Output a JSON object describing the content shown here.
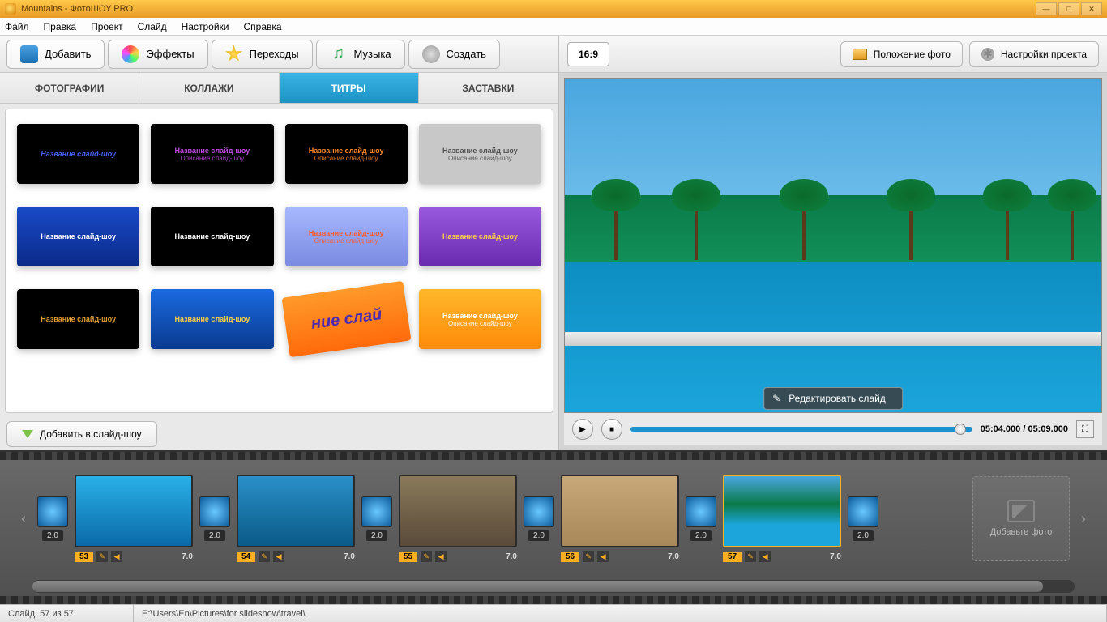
{
  "window": {
    "title": "Mountains - ФотоШОУ PRO"
  },
  "menu": [
    "Файл",
    "Правка",
    "Проект",
    "Слайд",
    "Настройки",
    "Справка"
  ],
  "toolbar": {
    "add": "Добавить",
    "effects": "Эффекты",
    "transitions": "Переходы",
    "music": "Музыка",
    "create": "Создать"
  },
  "subtabs": {
    "photos": "ФОТОГРАФИИ",
    "collages": "КОЛЛАЖИ",
    "titles": "ТИТРЫ",
    "intros": "ЗАСТАВКИ",
    "active": "titles"
  },
  "titleCards": [
    {
      "bg": "#000",
      "fg": "#4a60ff",
      "l1": "Название слайд-шоу",
      "style": "italic"
    },
    {
      "bg": "#000",
      "fg": "#c04ae0",
      "l1": "Название слайд-шоу",
      "l2": "Описание слайд-шоу"
    },
    {
      "bg": "#000",
      "fg": "#ff8a2a",
      "l1": "Название слайд-шоу",
      "l2": "Описание слайд-шоу"
    },
    {
      "bg": "#c8c8c8",
      "fg": "#505050",
      "l1": "Название слайд-шоу",
      "l2": "Описание слайд-шоу"
    },
    {
      "bg": "linear-gradient(#1a4ac8,#0a2a88)",
      "fg": "#ffffff",
      "l1": "Название слайд-шоу"
    },
    {
      "bg": "#000",
      "fg": "#ffffff",
      "l1": "Название слайд-шоу"
    },
    {
      "bg": "linear-gradient(#a8b8ff,#7a8ae0)",
      "fg": "#ff5a2a",
      "l1": "Название слайд-шоу",
      "l2": "Описание слайд-шоу"
    },
    {
      "bg": "linear-gradient(#9a5ae0,#6a2ab0)",
      "fg": "#ffd040",
      "l1": "Название слайд-шоу"
    },
    {
      "bg": "#000",
      "fg": "#e0a030",
      "l1": "Название слайд-шоу"
    },
    {
      "bg": "linear-gradient(#1a6ae0,#0a3a90)",
      "fg": "#ffd040",
      "l1": "Название слайд-шоу"
    },
    {
      "bg": "linear-gradient(#ff9a2a,#ff6a0a)",
      "fg": "#4a2ab0",
      "l1": "ние слай",
      "style": "big-diag"
    },
    {
      "bg": "linear-gradient(#ffb82a,#ff8a0a)",
      "fg": "#ffffff",
      "l1": "Название слайд-шоу",
      "l2": "Описание слайд-шоу"
    }
  ],
  "addToSlideshow": "Добавить в слайд-шоу",
  "preview": {
    "aspect": "16:9",
    "photoPosition": "Положение фото",
    "projectSettings": "Настройки проекта",
    "editSlide": "Редактировать слайд",
    "time": "05:04.000 / 05:09.000"
  },
  "timeline": {
    "transitions": [
      {
        "dur": "2.0"
      },
      {
        "dur": "2.0"
      },
      {
        "dur": "2.0"
      },
      {
        "dur": "2.0"
      },
      {
        "dur": "2.0"
      },
      {
        "dur": "2.0"
      }
    ],
    "slides": [
      {
        "num": "53",
        "dur": "7.0",
        "bg": "linear-gradient(#2ab0e8,#0a6aa8)",
        "selected": false
      },
      {
        "num": "54",
        "dur": "7.0",
        "bg": "linear-gradient(#2a90c8,#0a5a88)",
        "selected": false
      },
      {
        "num": "55",
        "dur": "7.0",
        "bg": "linear-gradient(#8a7a5a,#5a4a3a)",
        "selected": false
      },
      {
        "num": "56",
        "dur": "7.0",
        "bg": "linear-gradient(#c8a878,#a88858)",
        "selected": false
      },
      {
        "num": "57",
        "dur": "7.0",
        "bg": "linear-gradient(180deg,#4aa6e0 0%,#0a7a48 40%,#1ba5db 70%)",
        "selected": true
      }
    ],
    "addPhoto": "Добавьте фото"
  },
  "status": {
    "slideInfo": "Слайд: 57 из 57",
    "path": "E:\\Users\\En\\Pictures\\for slideshow\\travel\\"
  }
}
